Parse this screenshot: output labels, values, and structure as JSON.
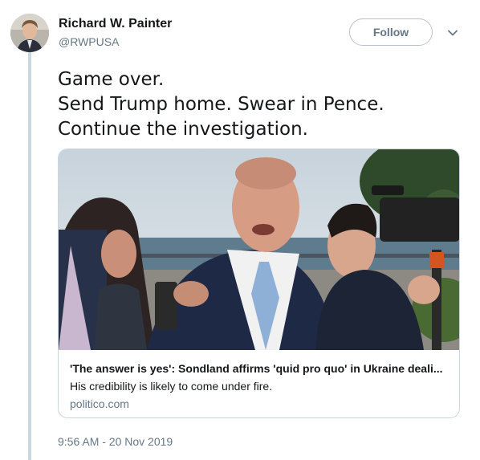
{
  "author": {
    "name": "Richard W. Painter",
    "handle": "@RWPUSA"
  },
  "follow_button": {
    "label": "Follow"
  },
  "menu": {
    "icon": "chevron-down-icon"
  },
  "tweet": {
    "lines": [
      "Game over.",
      "Send Trump home. Swear in Pence.",
      "Continue the investigation."
    ],
    "timestamp": "9:56 AM - 20 Nov 2019"
  },
  "card": {
    "title": "'The answer is yes': Sondland affirms 'quid pro quo' in Ukraine deali...",
    "description": "His credibility is likely to come under fire.",
    "domain": "politico.com"
  },
  "colors": {
    "text": "#14171a",
    "secondary": "#657786",
    "border": "#ccd6dd",
    "thread_line": "#ccd6dd"
  }
}
